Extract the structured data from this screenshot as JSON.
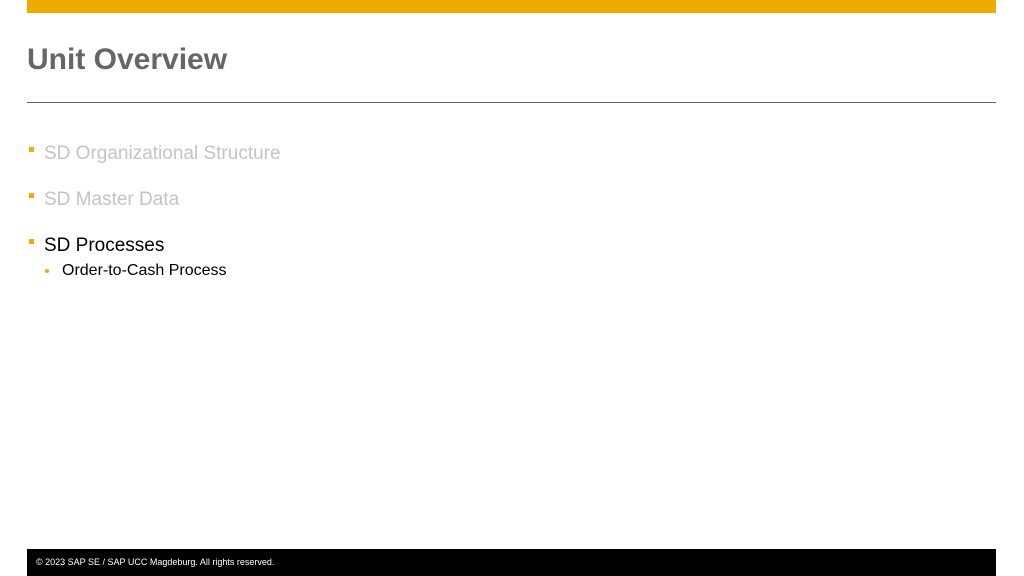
{
  "colors": {
    "accent": "#f0ab00",
    "title_text": "#666666",
    "dimmed_text": "#c4c4c4",
    "active_text": "#000000",
    "footer_background": "#000000",
    "footer_text": "#ffffff"
  },
  "slide": {
    "title": "Unit Overview",
    "items": [
      {
        "label": "SD Organizational Structure",
        "state": "dimmed"
      },
      {
        "label": "SD Master Data",
        "state": "dimmed"
      },
      {
        "label": "SD Processes",
        "state": "active",
        "subitems": [
          {
            "label": "Order-to-Cash Process"
          }
        ]
      }
    ]
  },
  "footer": {
    "copyright": "© 2023 SAP SE / SAP UCC Magdeburg. All rights reserved."
  }
}
